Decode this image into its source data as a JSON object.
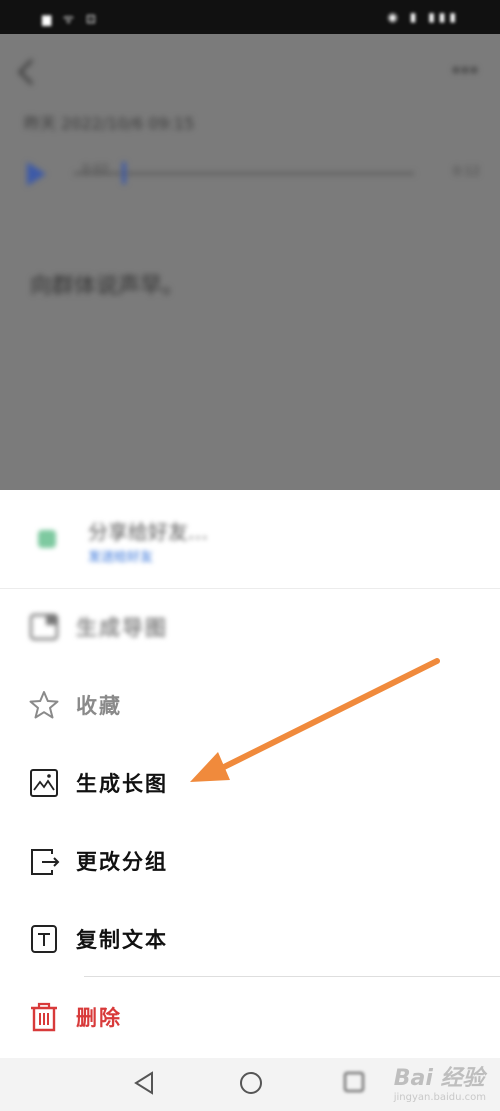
{
  "status_bar": {
    "left": "▆ ᯤ ⊡",
    "right": "◉ ▮ ▮▮▮"
  },
  "background": {
    "date": "昨天 2022/10/6 09:15",
    "audio_time": "0:02",
    "audio_duration": "0:12",
    "body": "向群体说声早。"
  },
  "sheet": {
    "share_title": "分享给好友…",
    "share_subtitle": "发送给好友",
    "items": [
      {
        "label": "生成导图"
      },
      {
        "label": "收藏"
      },
      {
        "label": "生成长图"
      },
      {
        "label": "更改分组"
      },
      {
        "label": "复制文本"
      },
      {
        "label": "删除"
      }
    ]
  },
  "colors": {
    "accent_arrow": "#f08a3c",
    "delete": "#d83a3a",
    "audio_accent": "#3d5aa8"
  },
  "watermark": {
    "brand": "Bai 经验",
    "url": "jingyan.baidu.com"
  }
}
